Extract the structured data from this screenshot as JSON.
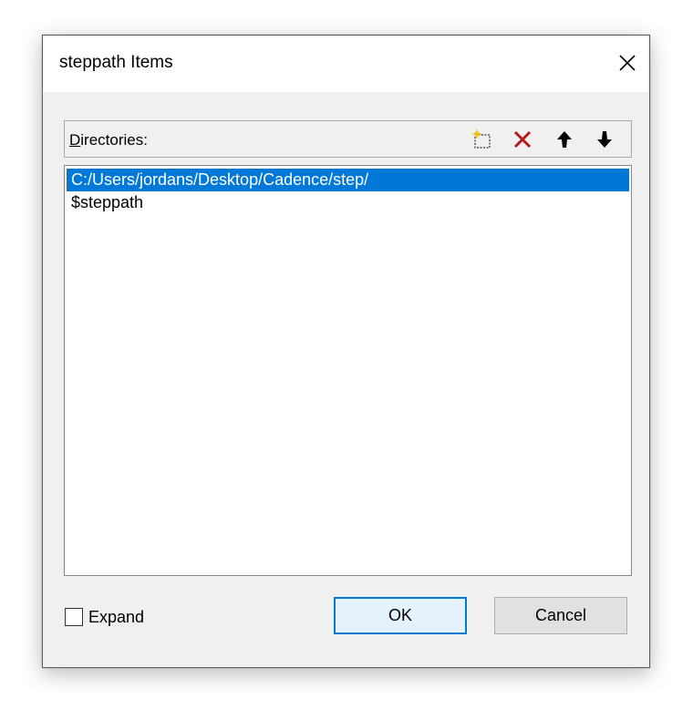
{
  "dialog": {
    "title": "steppath Items"
  },
  "directories": {
    "label_accel": "D",
    "label_rest": "irectories:",
    "items": [
      {
        "path": "C:/Users/jordans/Desktop/Cadence/step/",
        "selected": true
      },
      {
        "path": "$steppath",
        "selected": false
      }
    ]
  },
  "toolbar": {
    "icons": [
      "new-folder-icon",
      "delete-icon",
      "move-up-icon",
      "move-down-icon"
    ],
    "delete_color": "#c0392b"
  },
  "footer": {
    "expand_label": "Expand",
    "expand_checked": false,
    "ok_label": "OK",
    "cancel_label": "Cancel"
  },
  "colors": {
    "selection": "#0078d7",
    "default_button_border": "#0078d7"
  }
}
